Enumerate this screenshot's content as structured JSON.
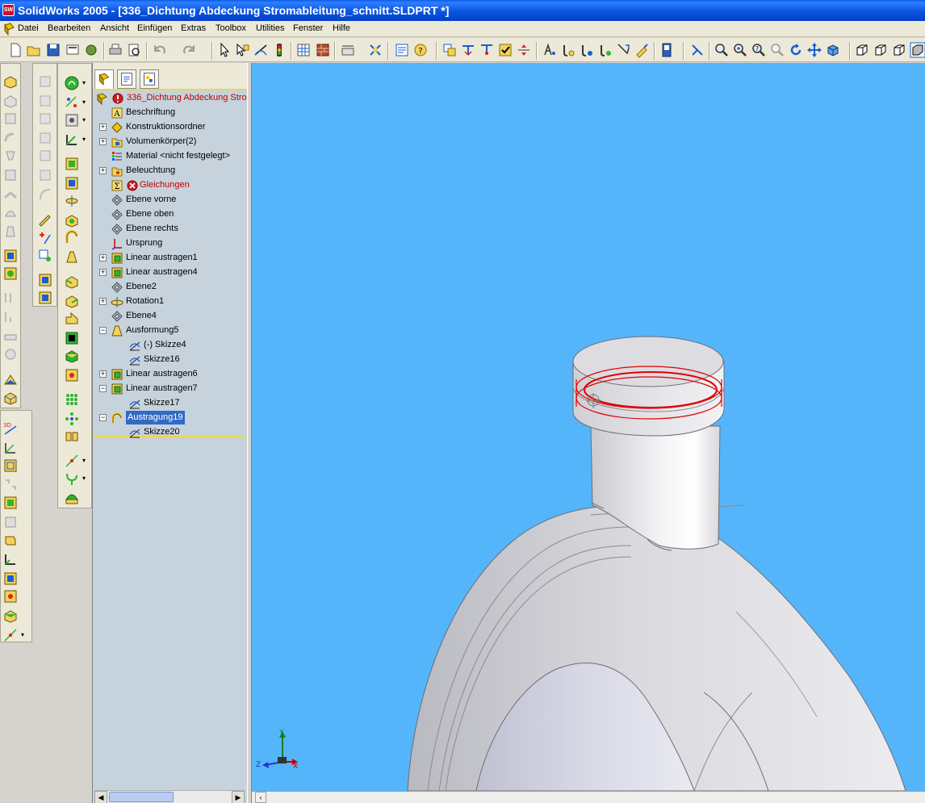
{
  "window": {
    "title": "SolidWorks 2005 - [336_Dichtung Abdeckung Stromableitung_schnitt.SLDPRT *]",
    "logo_text": "SW"
  },
  "menu": {
    "items": [
      "Datei",
      "Bearbeiten",
      "Ansicht",
      "Einfügen",
      "Extras",
      "Toolbox",
      "Utilities",
      "Fenster",
      "Hilfe"
    ]
  },
  "toolbar": {
    "icons": [
      "new-icon",
      "open-icon",
      "save-icon",
      "print-setup-icon",
      "options-icon",
      "print-icon",
      "print-preview-icon",
      "undo-icon",
      "redo-icon",
      "select-icon",
      "select-other-icon",
      "sketch-icon",
      "rebuild-icon",
      "grid-icon",
      "pattern-icon",
      "dimension-icon",
      "relation-icon",
      "properties-icon",
      "help-icon",
      "insert-component-icon",
      "mate-icon",
      "move-icon",
      "check-icon",
      "section-icon",
      "measure-icon",
      "mass-props-icon",
      "section-props-icon",
      "sensor-icon",
      "edit-icon",
      "macro-icon",
      "pointer-icon",
      "zoom-fit-icon",
      "zoom-area-icon",
      "zoom-in-out-icon",
      "zoom-selection-icon",
      "rotate-icon",
      "pan-icon",
      "view-orient-icon",
      "isometric-icon",
      "hidden-lines-icon",
      "wireframe-icon",
      "shaded-icon"
    ]
  },
  "feature_manager": {
    "tabs": [
      "feature-tree-tab",
      "property-manager-tab",
      "configuration-tab"
    ],
    "root": "336_Dichtung Abdeckung Stro",
    "items": [
      {
        "label": "Beschriftung",
        "icon": "annotations-icon",
        "expand": "",
        "indent": 0
      },
      {
        "label": "Konstruktionsordner",
        "icon": "design-binder-icon",
        "expand": "+",
        "indent": 0
      },
      {
        "label": "Volumenkörper(2)",
        "icon": "solid-bodies-icon",
        "expand": "+",
        "indent": 0
      },
      {
        "label": "Material <nicht festgelegt>",
        "icon": "material-icon",
        "expand": "",
        "indent": 0
      },
      {
        "label": "Beleuchtung",
        "icon": "lighting-icon",
        "expand": "+",
        "indent": 0
      },
      {
        "label": "Gleichungen",
        "icon": "equations-icon",
        "expand": "",
        "indent": 0,
        "error": true
      },
      {
        "label": "Ebene vorne",
        "icon": "plane-icon",
        "expand": "",
        "indent": 0
      },
      {
        "label": "Ebene oben",
        "icon": "plane-icon",
        "expand": "",
        "indent": 0
      },
      {
        "label": "Ebene rechts",
        "icon": "plane-icon",
        "expand": "",
        "indent": 0
      },
      {
        "label": "Ursprung",
        "icon": "origin-icon",
        "expand": "",
        "indent": 0
      },
      {
        "label": "Linear austragen1",
        "icon": "extrude-icon",
        "expand": "+",
        "indent": 0
      },
      {
        "label": "Linear austragen4",
        "icon": "extrude-icon",
        "expand": "+",
        "indent": 0
      },
      {
        "label": "Ebene2",
        "icon": "plane-icon",
        "expand": "",
        "indent": 0
      },
      {
        "label": "Rotation1",
        "icon": "revolve-icon",
        "expand": "+",
        "indent": 0
      },
      {
        "label": "Ebene4",
        "icon": "plane-icon",
        "expand": "",
        "indent": 0
      },
      {
        "label": "Ausformung5",
        "icon": "loft-icon",
        "expand": "−",
        "indent": 0
      },
      {
        "label": "(-) Skizze4",
        "icon": "sketch-icon",
        "expand": "",
        "indent": 1
      },
      {
        "label": "Skizze16",
        "icon": "sketch-icon",
        "expand": "",
        "indent": 1
      },
      {
        "label": "Linear austragen6",
        "icon": "extrude-icon",
        "expand": "+",
        "indent": 0
      },
      {
        "label": "Linear austragen7",
        "icon": "extrude-icon",
        "expand": "−",
        "indent": 0
      },
      {
        "label": "Skizze17",
        "icon": "sketch-icon",
        "expand": "",
        "indent": 1
      },
      {
        "label": "Austragung19",
        "icon": "sweep-icon",
        "expand": "−",
        "indent": 0,
        "selected": true
      },
      {
        "label": "Skizze20",
        "icon": "sketch-icon",
        "expand": "",
        "indent": 1
      }
    ]
  },
  "triad": {
    "x": "X",
    "y": "Y",
    "z": "Z"
  },
  "colors": {
    "viewport_bg": "#55b5fa",
    "selection": "#316ac5",
    "error": "#c00000",
    "sketch_red": "#e00000"
  }
}
